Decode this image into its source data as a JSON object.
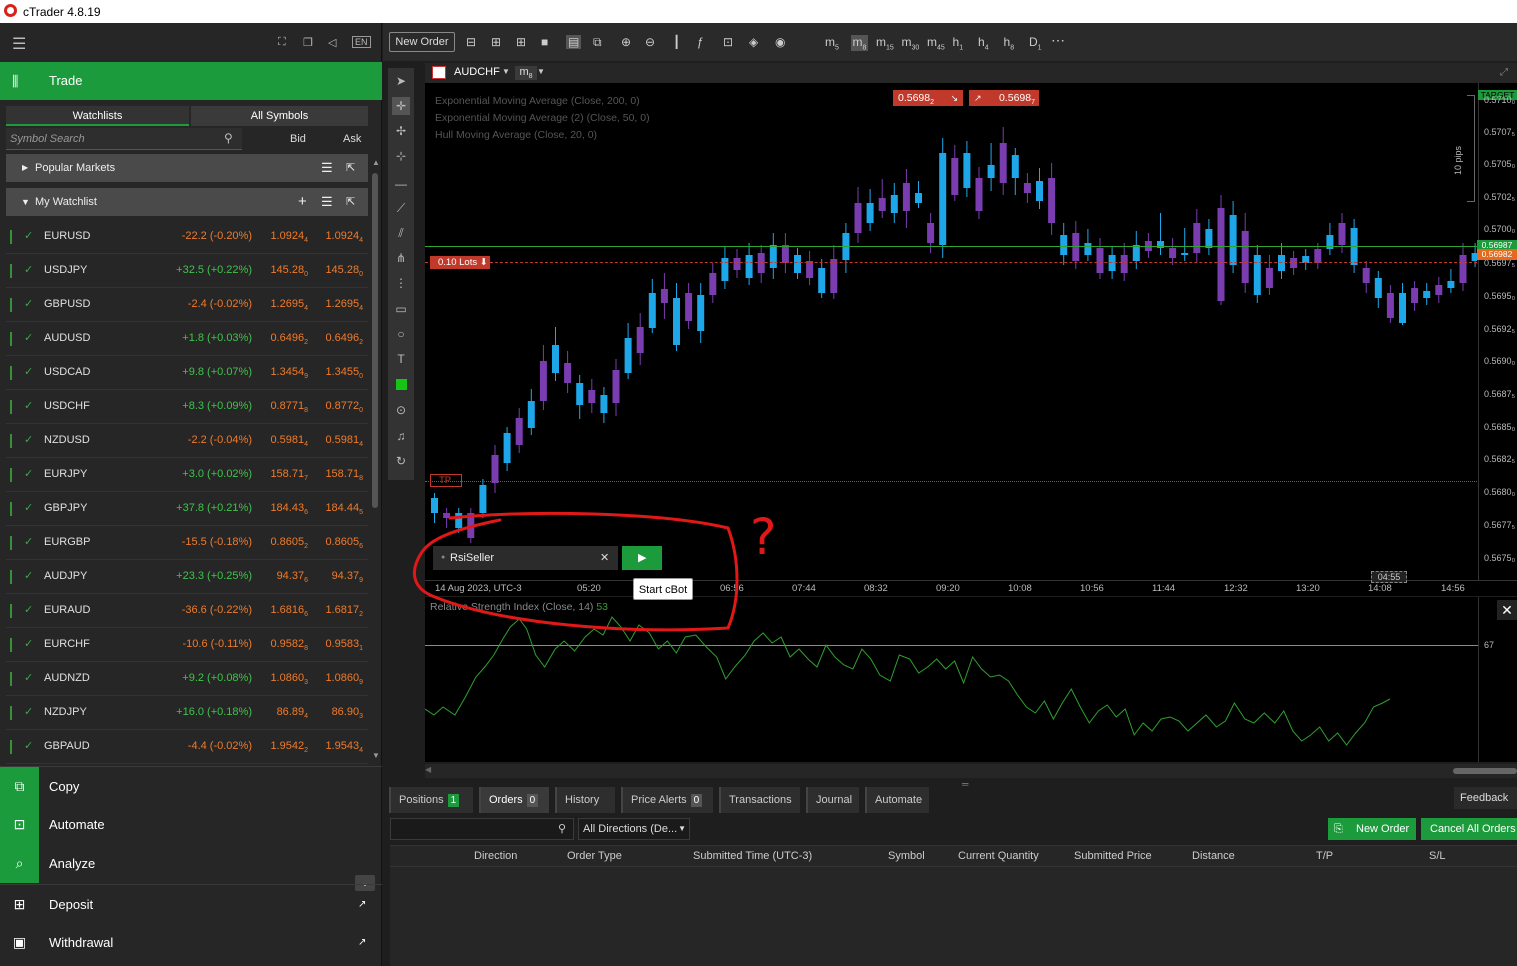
{
  "app": {
    "title": "cTrader 4.8.19"
  },
  "left": {
    "trade_label": "Trade",
    "tabs": [
      "Watchlists",
      "All Symbols"
    ],
    "search_placeholder": "Symbol Search",
    "bid_label": "Bid",
    "ask_label": "Ask",
    "lang": "EN",
    "popular": "Popular Markets",
    "watchlist": "My Watchlist",
    "rows": [
      {
        "sym": "EURUSD",
        "chg": "-22.2 (-0.20%)",
        "dir": "dn",
        "bid": "1.0924",
        "bid_sub": "4",
        "ask": "1.0924",
        "ask_sub": "4"
      },
      {
        "sym": "USDJPY",
        "chg": "+32.5 (+0.22%)",
        "dir": "up",
        "bid": "145.28",
        "bid_sub": "0",
        "ask": "145.28",
        "ask_sub": "0"
      },
      {
        "sym": "GBPUSD",
        "chg": "-2.4 (-0.02%)",
        "dir": "dn",
        "bid": "1.2695",
        "bid_sub": "4",
        "ask": "1.2695",
        "ask_sub": "4"
      },
      {
        "sym": "AUDUSD",
        "chg": "+1.8 (+0.03%)",
        "dir": "up",
        "bid": "0.6496",
        "bid_sub": "2",
        "ask": "0.6496",
        "ask_sub": "2"
      },
      {
        "sym": "USDCAD",
        "chg": "+9.8 (+0.07%)",
        "dir": "up",
        "bid": "1.3454",
        "bid_sub": "9",
        "ask": "1.3455",
        "ask_sub": "0"
      },
      {
        "sym": "USDCHF",
        "chg": "+8.3 (+0.09%)",
        "dir": "up",
        "bid": "0.8771",
        "bid_sub": "8",
        "ask": "0.8772",
        "ask_sub": "0"
      },
      {
        "sym": "NZDUSD",
        "chg": "-2.2 (-0.04%)",
        "dir": "dn",
        "bid": "0.5981",
        "bid_sub": "4",
        "ask": "0.5981",
        "ask_sub": "4"
      },
      {
        "sym": "EURJPY",
        "chg": "+3.0 (+0.02%)",
        "dir": "up",
        "bid": "158.71",
        "bid_sub": "7",
        "ask": "158.71",
        "ask_sub": "8"
      },
      {
        "sym": "GBPJPY",
        "chg": "+37.8 (+0.21%)",
        "dir": "up",
        "bid": "184.43",
        "bid_sub": "6",
        "ask": "184.44",
        "ask_sub": "5"
      },
      {
        "sym": "EURGBP",
        "chg": "-15.5 (-0.18%)",
        "dir": "dn",
        "bid": "0.8605",
        "bid_sub": "2",
        "ask": "0.8605",
        "ask_sub": "6"
      },
      {
        "sym": "AUDJPY",
        "chg": "+23.3 (+0.25%)",
        "dir": "up",
        "bid": "94.37",
        "bid_sub": "6",
        "ask": "94.37",
        "ask_sub": "9"
      },
      {
        "sym": "EURAUD",
        "chg": "-36.6 (-0.22%)",
        "dir": "dn",
        "bid": "1.6816",
        "bid_sub": "6",
        "ask": "1.6817",
        "ask_sub": "2"
      },
      {
        "sym": "EURCHF",
        "chg": "-10.6 (-0.11%)",
        "dir": "dn",
        "bid": "0.9582",
        "bid_sub": "8",
        "ask": "0.9583",
        "ask_sub": "1"
      },
      {
        "sym": "AUDNZD",
        "chg": "+9.2 (+0.08%)",
        "dir": "up",
        "bid": "1.0860",
        "bid_sub": "3",
        "ask": "1.0860",
        "ask_sub": "9"
      },
      {
        "sym": "NZDJPY",
        "chg": "+16.0 (+0.18%)",
        "dir": "up",
        "bid": "86.89",
        "bid_sub": "4",
        "ask": "86.90",
        "ask_sub": "3"
      },
      {
        "sym": "GBPAUD",
        "chg": "-4.4 (-0.02%)",
        "dir": "dn",
        "bid": "1.9542",
        "bid_sub": "2",
        "ask": "1.9543",
        "ask_sub": "4"
      }
    ],
    "nav": [
      "Copy",
      "Automate",
      "Analyze",
      "Deposit",
      "Withdrawal"
    ]
  },
  "toolbar": {
    "new_order": "New Order",
    "timeframes": [
      {
        "l": "m",
        "s": "5"
      },
      {
        "l": "m",
        "s": "8"
      },
      {
        "l": "m",
        "s": "15"
      },
      {
        "l": "m",
        "s": "30"
      },
      {
        "l": "m",
        "s": "45"
      },
      {
        "l": "h",
        "s": "1"
      },
      {
        "l": "h",
        "s": "4"
      },
      {
        "l": "h",
        "s": "8"
      },
      {
        "l": "D",
        "s": "1"
      }
    ]
  },
  "chart": {
    "symbol": "AUDCHF",
    "timeframe": "m",
    "timeframe_sub": "8",
    "indicators": [
      "Exponential Moving Average (Close, 200, 0)",
      "Exponential Moving Average (2) (Close, 50, 0)",
      "Hull Moving Average (Close, 20, 0)"
    ],
    "sell_price": "0.5698",
    "sell_sub": "2",
    "buy_price": "0.5698",
    "buy_sub": "7",
    "lots_label": "0.10 Lots",
    "tp_label": "TP",
    "target_label": "TARGET",
    "pips_label": "10 pips",
    "y_ticks": [
      "0.5710₀",
      "0.5707₅",
      "0.5705₀",
      "0.5702₅",
      "0.5700₀",
      "0.56987",
      "0.56982",
      "0.5697₅",
      "0.5695₀",
      "0.5692₅",
      "0.5690₀",
      "0.5687₅",
      "0.5685₀",
      "0.5682₅",
      "0.5680₀",
      "0.5677₅",
      "0.5675₀"
    ],
    "x_ticks": [
      "14 Aug 2023, UTC-3",
      "05:20",
      "06:56",
      "07:44",
      "08:32",
      "09:20",
      "10:08",
      "10:56",
      "11:44",
      "12:32",
      "13:20",
      "14:08",
      "14:56"
    ],
    "countdown": "04:55",
    "cbot_name": "RsiSeller",
    "tooltip": "Start cBot",
    "question_mark": "?"
  },
  "rsi": {
    "label": "Relative Strength Index (Close, 14)",
    "value": "53",
    "level": "67"
  },
  "bottom": {
    "tabs": [
      {
        "label": "Positions",
        "n": "1"
      },
      {
        "label": "Orders",
        "n": "0"
      },
      {
        "label": "History"
      },
      {
        "label": "Price Alerts",
        "n": "0"
      },
      {
        "label": "Transactions"
      },
      {
        "label": "Journal"
      },
      {
        "label": "Automate"
      }
    ],
    "feedback": "Feedback",
    "direction_filter": "All Directions (De...",
    "new_order": "New Order",
    "cancel_all": "Cancel All Orders",
    "columns": [
      "Direction",
      "Order Type",
      "Submitted Time (UTC-3)",
      "Symbol",
      "Current Quantity",
      "Submitted Price",
      "Distance",
      "T/P",
      "S/L"
    ]
  },
  "colors": {
    "up_candle": "#1ea7e8",
    "down_candle": "#7a3db0",
    "accent": "#1c9b3c",
    "sell": "#c0392b",
    "annotation": "#e01818",
    "rsi_line": "#2fa02f",
    "rsi_level": "#3aa6d0"
  }
}
